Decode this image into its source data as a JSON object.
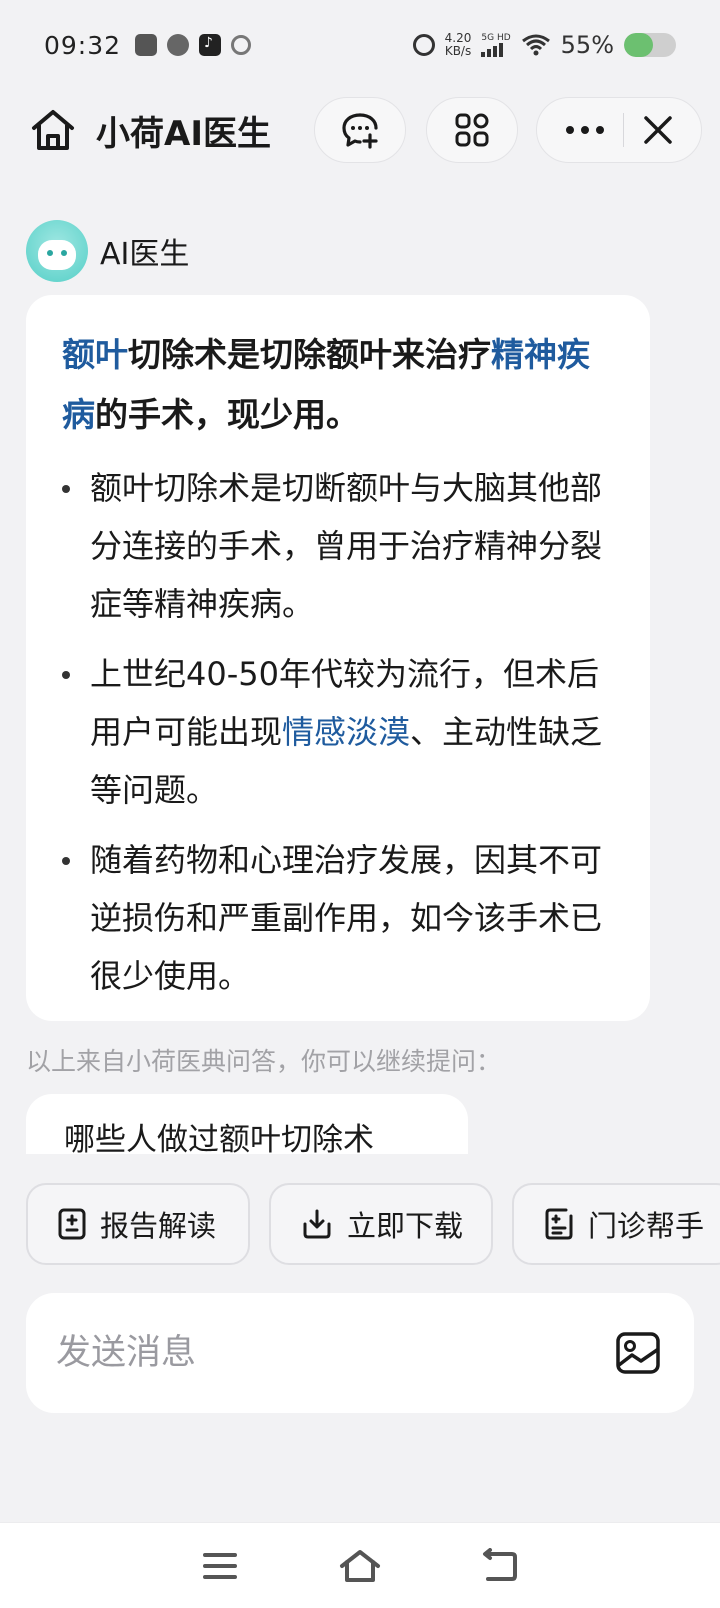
{
  "status_bar": {
    "time": "09:32",
    "net_speed_value": "4.20",
    "net_speed_unit": "KB/s",
    "network_tag": "5G HD",
    "battery_percent_text": "55%",
    "battery_level": 0.55,
    "battery_color": "#6cc070"
  },
  "header": {
    "title": "小荷AI医生"
  },
  "assistant": {
    "name": "AI医生"
  },
  "answer": {
    "headline": {
      "kw1": "额叶",
      "text1": "切除术是切除额叶来治疗",
      "kw2": "精神疾病",
      "text2": "的手术，现少用。"
    },
    "bullets": [
      {
        "text": "额叶切除术是切断额叶与大脑其他部分连接的手术，曾用于治疗精神分裂症等精神疾病。"
      },
      {
        "pre": "上世纪40-50年代较为流行，但术后用户可能出现",
        "kw": "情感淡漠",
        "post": "、主动性缺乏等问题。"
      },
      {
        "text": "随着药物和心理治疗发展，因其不可逆损伤和严重副作用，如今该手术已很少使用。"
      }
    ],
    "keyword_color": "#1f5b9e"
  },
  "source_note": "以上来自小荷医典问答，你可以继续提问：",
  "suggestion": "哪些人做过额叶切除术",
  "tools": [
    {
      "label": "报告解读",
      "icon": "report-icon"
    },
    {
      "label": "立即下载",
      "icon": "download-icon"
    },
    {
      "label": "门诊帮手",
      "icon": "clinic-icon"
    }
  ],
  "input": {
    "placeholder": "发送消息"
  }
}
